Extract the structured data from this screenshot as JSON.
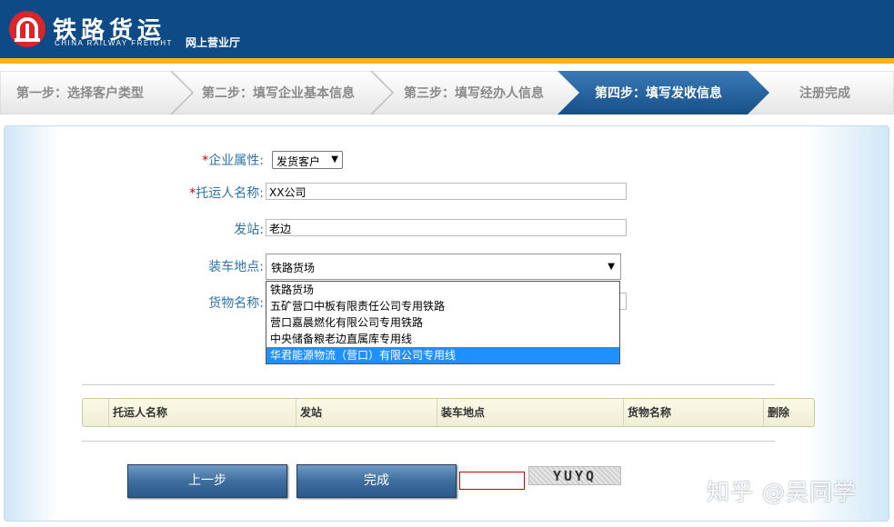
{
  "header": {
    "brand_cn": "铁路货运",
    "brand_en": "CHINA RAILWAY FREIGHT",
    "subtitle": "网上营业厅"
  },
  "steps": [
    {
      "label": "第一步：选择客户类型",
      "active": false
    },
    {
      "label": "第二步：填写企业基本信息",
      "active": false
    },
    {
      "label": "第三步：填写经办人信息",
      "active": false
    },
    {
      "label": "第四步：填写发收信息",
      "active": true
    },
    {
      "label": "注册完成",
      "active": false
    }
  ],
  "form": {
    "enterprise_attr": {
      "label": "企业属性:",
      "required_mark": "*",
      "value": "发货客户"
    },
    "shipper_name": {
      "label": "托运人名称:",
      "required_mark": "*",
      "value": "XX公司"
    },
    "origin_station": {
      "label": "发站:",
      "value": "老边"
    },
    "loading_location": {
      "label": "装车地点:",
      "value": "铁路货场",
      "options": [
        "铁路货场",
        "五矿营口中板有限责任公司专用铁路",
        "营口嘉晨燃化有限公司专用铁路",
        "中央储备粮老边直属库专用线",
        "华君能源物流（营口）有限公司专用线"
      ],
      "highlighted_index": 4
    },
    "goods_name": {
      "label": "货物名称:"
    }
  },
  "table": {
    "columns": [
      "托运人名称",
      "发站",
      "装车地点",
      "货物名称",
      "删除"
    ]
  },
  "buttons": {
    "prev": "上一步",
    "finish": "完成"
  },
  "captcha": {
    "text": "YUYQ"
  },
  "watermark": "知乎 @吴同学",
  "colors": {
    "header_bg": "#0e4a86",
    "header_stripe": "#f2b516",
    "active_step": "#1e5c96",
    "label": "#2e74a8",
    "required": "#d00000",
    "dropdown_highlight": "#1e90ff"
  }
}
